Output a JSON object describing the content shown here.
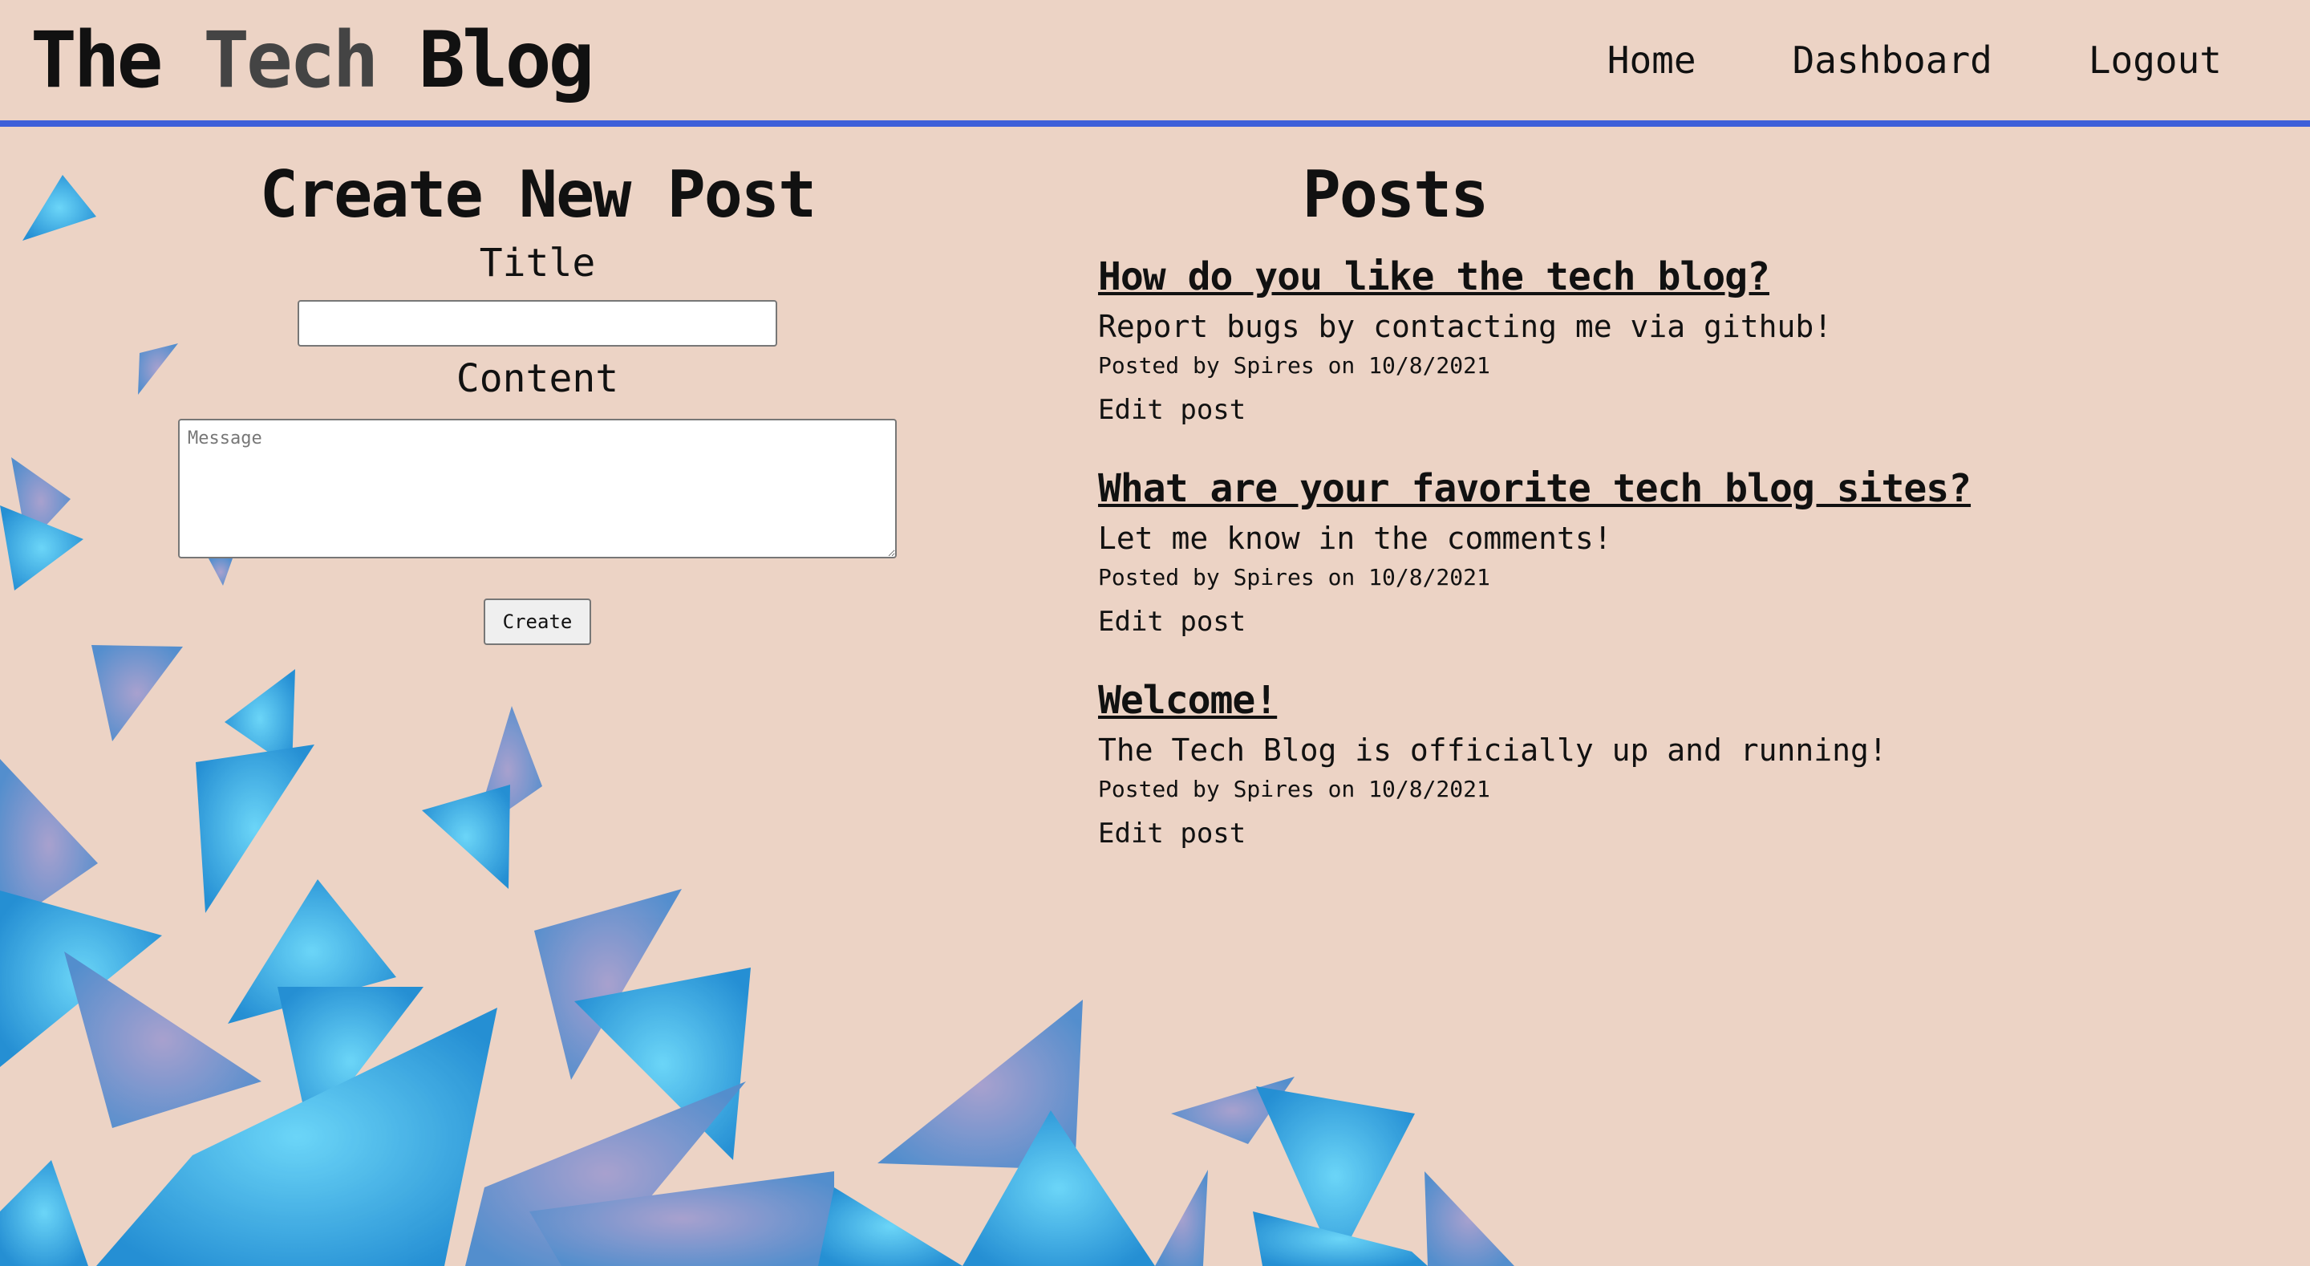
{
  "header": {
    "logo_part1": "The ",
    "logo_part2": "Tech",
    "logo_part3": " Blog",
    "nav": [
      "Home",
      "Dashboard",
      "Logout"
    ]
  },
  "create": {
    "heading": "Create New Post",
    "title_label": "Title",
    "content_label": "Content",
    "content_placeholder": "Message",
    "button": "Create"
  },
  "posts": {
    "heading": "Posts",
    "items": [
      {
        "title": "How do you like the tech blog?",
        "body": "Report bugs by contacting me via github!",
        "meta": "Posted by Spires on 10/8/2021",
        "edit": "Edit post"
      },
      {
        "title": "What are your favorite tech blog sites?",
        "body": "Let me know in the comments!",
        "meta": "Posted by Spires on 10/8/2021",
        "edit": "Edit post"
      },
      {
        "title": "Welcome!",
        "body": "The Tech Blog is officially up and running!",
        "meta": "Posted by Spires on 10/8/2021",
        "edit": "Edit post"
      }
    ]
  },
  "colors": {
    "background": "#ecd3c5",
    "header_rule": "#3d5fd9",
    "triangle_light": "#4fd2ff",
    "triangle_dark": "#0a5ec8"
  }
}
